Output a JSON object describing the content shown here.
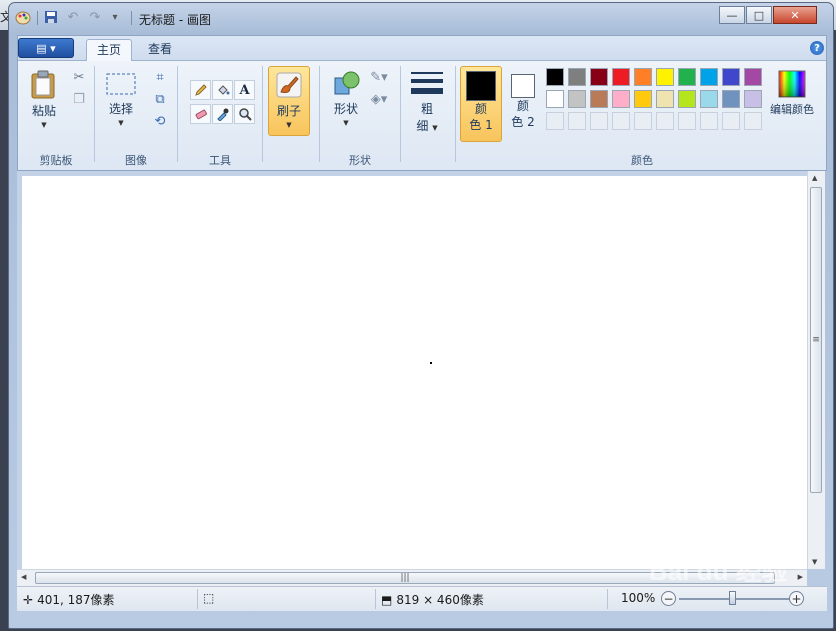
{
  "background": {
    "left_text": "文件"
  },
  "titlebar": {
    "title": "无标题 - 画图",
    "qat_dropdown": "▾"
  },
  "window_controls": {
    "minimize": "—",
    "maximize": "□",
    "close": "✕"
  },
  "ribbon": {
    "app_menu_label": "▤ ▾",
    "tabs": [
      {
        "label": "主页"
      },
      {
        "label": "查看"
      }
    ],
    "help": "?",
    "clipboard": {
      "paste_label": "粘贴",
      "group_label": "剪贴板"
    },
    "image": {
      "select_label": "选择",
      "group_label": "图像"
    },
    "tools": {
      "group_label": "工具",
      "text_tool": "A"
    },
    "brushes": {
      "label": "刷子"
    },
    "shapes": {
      "label": "形状",
      "group_label": "形状"
    },
    "size": {
      "label_line1": "粗",
      "label_line2": "细"
    },
    "colors": {
      "color1_line1": "颜",
      "color1_line2": "色 1",
      "color2_line1": "颜",
      "color2_line2": "色 2",
      "edit_colors_label": "编辑颜色",
      "group_label": "颜色",
      "color1_value": "#000000",
      "color2_value": "#ffffff",
      "palette_row1": [
        "#000000",
        "#7f7f7f",
        "#880015",
        "#ed1c24",
        "#ff7f27",
        "#fff200",
        "#22b14c",
        "#00a2e8",
        "#3f48cc",
        "#a349a4"
      ],
      "palette_row2": [
        "#ffffff",
        "#c3c3c3",
        "#b97a57",
        "#ffaec9",
        "#ffc90e",
        "#efe4b0",
        "#b5e61d",
        "#99d9ea",
        "#7092be",
        "#c8bfe7"
      ]
    }
  },
  "statusbar": {
    "cursor_position": "401, 187像素",
    "canvas_size": "819 × 460像素",
    "zoom_level": "100%",
    "zoom_minus": "−",
    "zoom_plus": "+"
  },
  "watermark": "Bai du 经验"
}
